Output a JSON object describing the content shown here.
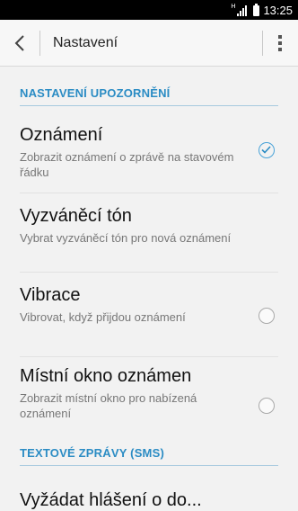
{
  "status_bar": {
    "network": "H",
    "time": "13:25"
  },
  "action_bar": {
    "title": "Nastavení"
  },
  "sections": [
    {
      "header": "NASTAVENÍ UPOZORNĚNÍ"
    },
    {
      "header": "TEXTOVÉ ZPRÁVY (SMS)"
    }
  ],
  "items": [
    {
      "title": "Oznámení",
      "summary": "Zobrazit oznámení o zprávě na stavovém řádku",
      "control": "checkbox",
      "checked": true
    },
    {
      "title": "Vyzváněcí tón",
      "summary": "Vybrat vyzváněcí tón pro nová oznámení",
      "control": "none"
    },
    {
      "title": "Vibrace",
      "summary": "Vibrovat, když přijdou oznámení",
      "control": "checkbox",
      "checked": false
    },
    {
      "title": "Místní okno oznámen",
      "summary": "Zobrazit místní okno pro nabízená oznámení",
      "control": "checkbox",
      "checked": false
    }
  ],
  "partial_item": {
    "title": "Vyžádat hlášení o do..."
  },
  "icons": {
    "back": "chevron-left-icon",
    "overflow": "overflow-menu-icon",
    "signal": "signal-icon",
    "battery": "battery-icon",
    "check": "check-icon"
  }
}
